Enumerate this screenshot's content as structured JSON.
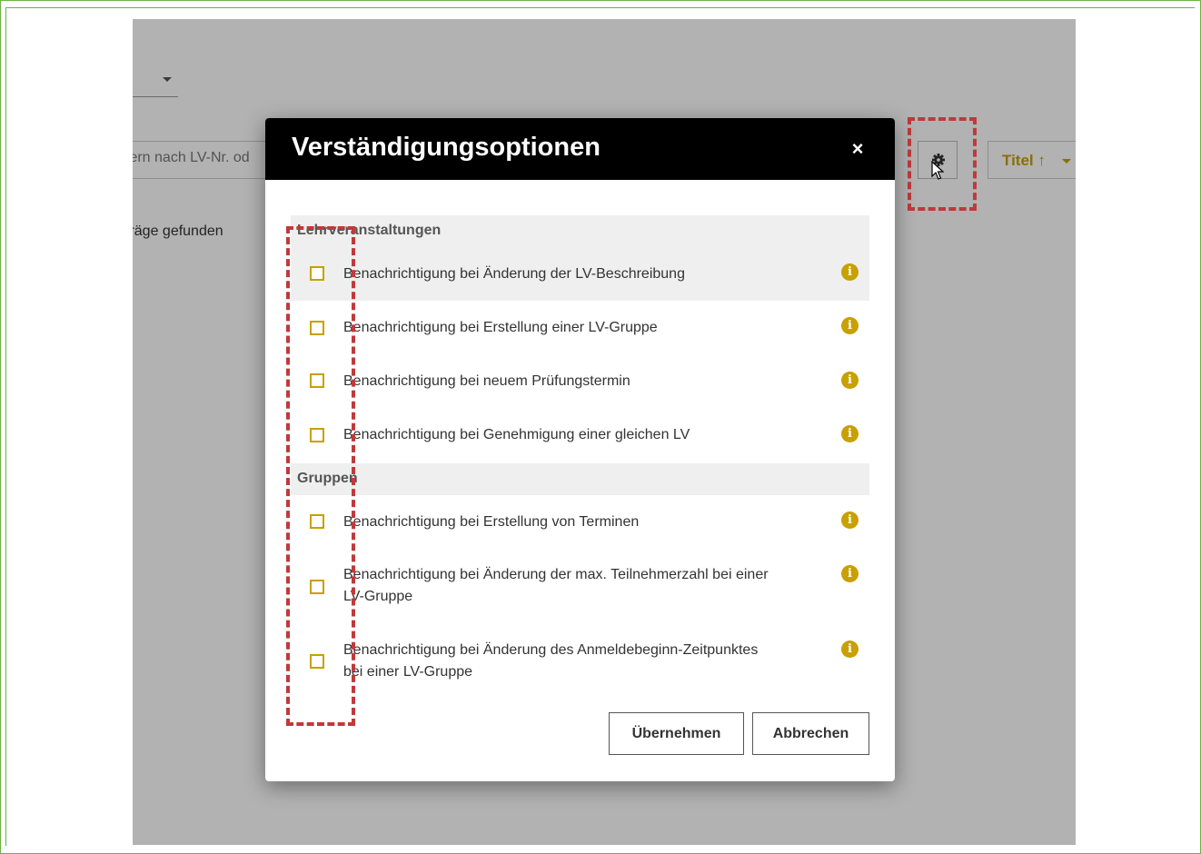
{
  "background": {
    "search_placeholder": "tern nach LV-Nr. od",
    "result_count": "träge gefunden",
    "sort_label": "Titel ↑"
  },
  "modal": {
    "title": "Verständigungsoptionen",
    "close": "×",
    "sections": [
      {
        "label": "Lehrveranstaltungen",
        "options": [
          {
            "label": "Benachrichtigung bei Änderung der LV-Beschreibung",
            "checked": false
          },
          {
            "label": "Benachrichtigung bei Erstellung einer LV-Gruppe",
            "checked": false
          },
          {
            "label": "Benachrichtigung bei neuem Prüfungstermin",
            "checked": false
          },
          {
            "label": "Benachrichtigung bei Genehmigung einer gleichen LV",
            "checked": false
          }
        ]
      },
      {
        "label": "Gruppen",
        "options": [
          {
            "label": "Benachrichtigung bei Erstellung von Terminen",
            "checked": false
          },
          {
            "label": "Benachrichtigung bei Änderung der max. Teilnehmerzahl bei einer LV-Gruppe",
            "checked": false
          },
          {
            "label": "Benachrichtigung bei Änderung des Anmeldebeginn-Zeitpunktes bei einer LV-Gruppe",
            "checked": false
          }
        ]
      }
    ],
    "apply_label": "Übernehmen",
    "cancel_label": "Abbrechen"
  },
  "colors": {
    "accent": "#c8a000",
    "highlight_dashed": "#c0393b",
    "frame": "#6cb33f",
    "header": "#000000"
  },
  "icons": {
    "settings": "gear-icon",
    "info": "info-icon",
    "close": "close-icon",
    "cursor": "mouse-cursor-icon"
  }
}
